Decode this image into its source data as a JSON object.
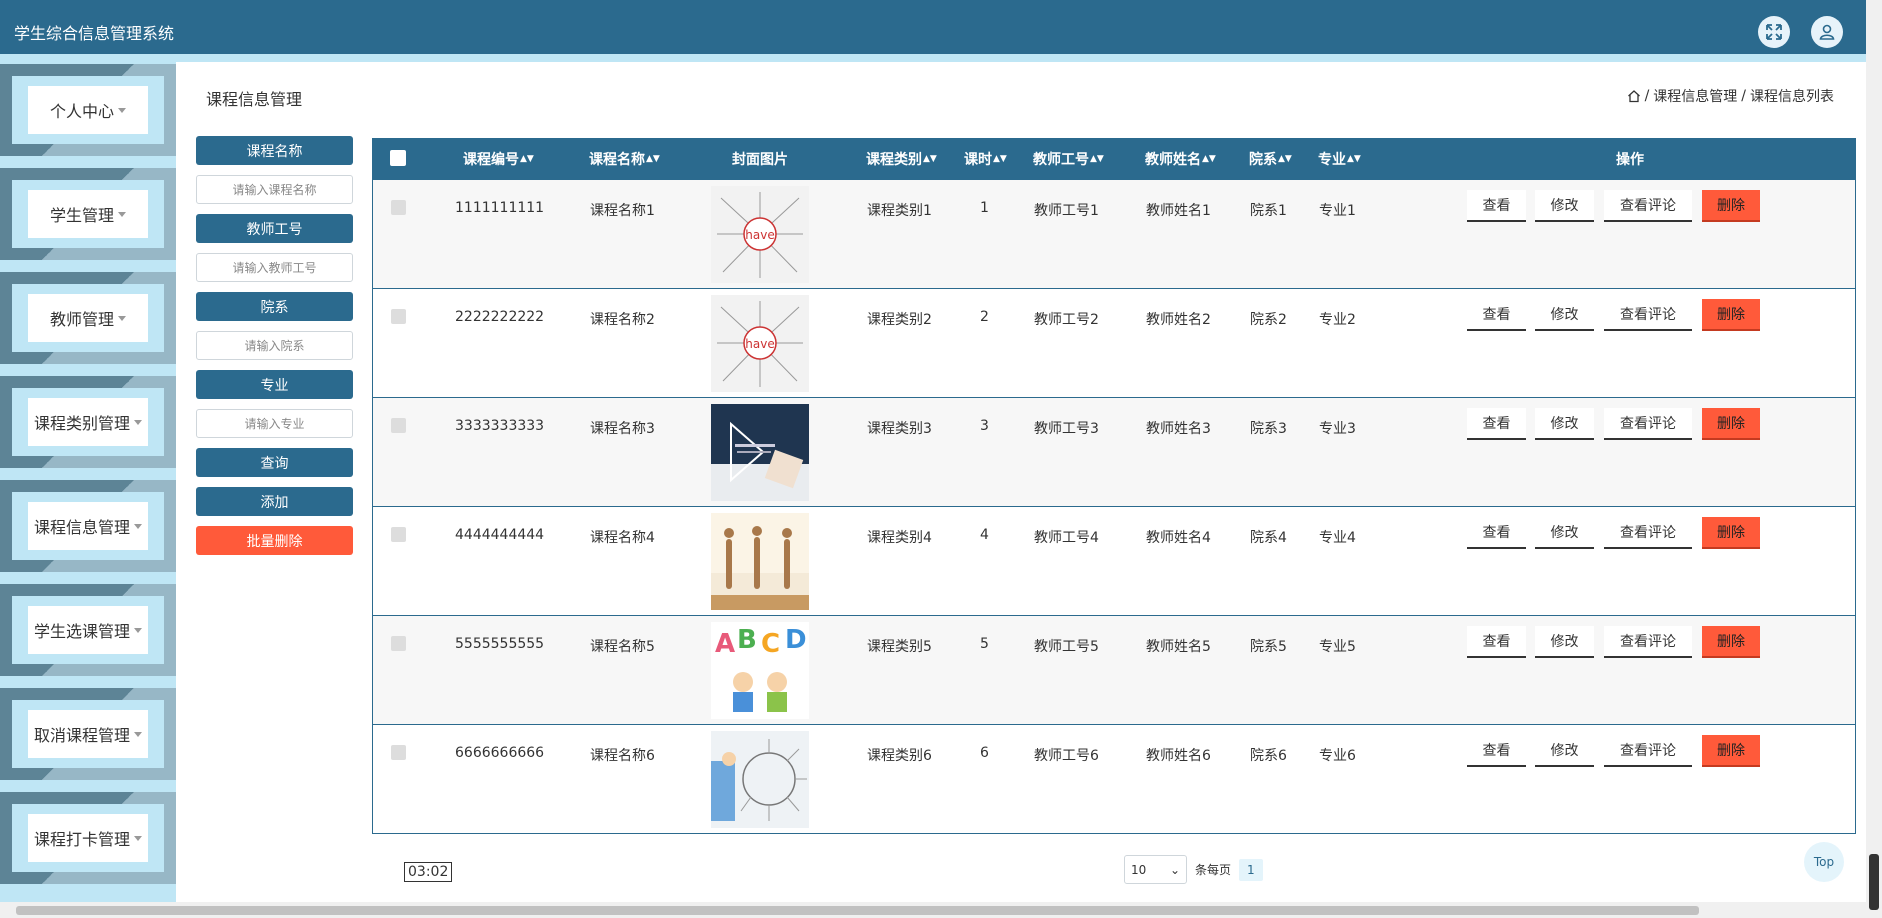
{
  "app": {
    "title": "学生综合信息管理系统"
  },
  "header": {
    "fullscreen_icon": "expand-icon",
    "user_icon": "user-icon"
  },
  "sidebar": {
    "items": [
      {
        "label": "个人中心"
      },
      {
        "label": "学生管理"
      },
      {
        "label": "教师管理"
      },
      {
        "label": "课程类别管理"
      },
      {
        "label": "课程信息管理"
      },
      {
        "label": "学生选课管理"
      },
      {
        "label": "取消课程管理"
      },
      {
        "label": "课程打卡管理"
      }
    ]
  },
  "page": {
    "title": "课程信息管理",
    "breadcrumb": [
      "课程信息管理",
      "课程信息列表"
    ]
  },
  "search": {
    "fields": [
      {
        "label": "课程名称",
        "placeholder": "请输入课程名称"
      },
      {
        "label": "教师工号",
        "placeholder": "请输入教师工号"
      },
      {
        "label": "院系",
        "placeholder": "请输入院系"
      },
      {
        "label": "专业",
        "placeholder": "请输入专业"
      }
    ],
    "query_label": "查询",
    "add_label": "添加",
    "batch_delete_label": "批量删除"
  },
  "table": {
    "columns": [
      "课程编号",
      "课程名称",
      "封面图片",
      "课程类别",
      "课时",
      "教师工号",
      "教师姓名",
      "院系",
      "专业",
      "操作"
    ],
    "actions": {
      "view": "查看",
      "edit": "修改",
      "comments": "查看评论",
      "delete": "删除"
    },
    "rows": [
      {
        "id": "1111111111",
        "name": "课程名称1",
        "category": "课程类别1",
        "hours": "1",
        "teacher_no": "教师工号1",
        "teacher_name": "教师姓名1",
        "dept": "院系1",
        "major": "专业1",
        "cover_text": "have"
      },
      {
        "id": "2222222222",
        "name": "课程名称2",
        "category": "课程类别2",
        "hours": "2",
        "teacher_no": "教师工号2",
        "teacher_name": "教师姓名2",
        "dept": "院系2",
        "major": "专业2",
        "cover_text": "have"
      },
      {
        "id": "3333333333",
        "name": "课程名称3",
        "category": "课程类别3",
        "hours": "3",
        "teacher_no": "教师工号3",
        "teacher_name": "教师姓名3",
        "dept": "院系3",
        "major": "专业3",
        "cover_text": ""
      },
      {
        "id": "4444444444",
        "name": "课程名称4",
        "category": "课程类别4",
        "hours": "4",
        "teacher_no": "教师工号4",
        "teacher_name": "教师姓名4",
        "dept": "院系4",
        "major": "专业4",
        "cover_text": ""
      },
      {
        "id": "5555555555",
        "name": "课程名称5",
        "category": "课程类别5",
        "hours": "5",
        "teacher_no": "教师工号5",
        "teacher_name": "教师姓名5",
        "dept": "院系5",
        "major": "专业5",
        "cover_text": "ABCD"
      },
      {
        "id": "6666666666",
        "name": "课程名称6",
        "category": "课程类别6",
        "hours": "6",
        "teacher_no": "教师工号6",
        "teacher_name": "教师姓名6",
        "dept": "院系6",
        "major": "专业6",
        "cover_text": ""
      }
    ]
  },
  "pagination": {
    "page_size": "10",
    "per_page_label": "条每页",
    "current_page": "1"
  },
  "timer": "03:02",
  "top_label": "Top",
  "colors": {
    "primary": "#2b6a8e",
    "danger": "#ff5a3a",
    "sidebar_bg": "#bfe6f5"
  }
}
